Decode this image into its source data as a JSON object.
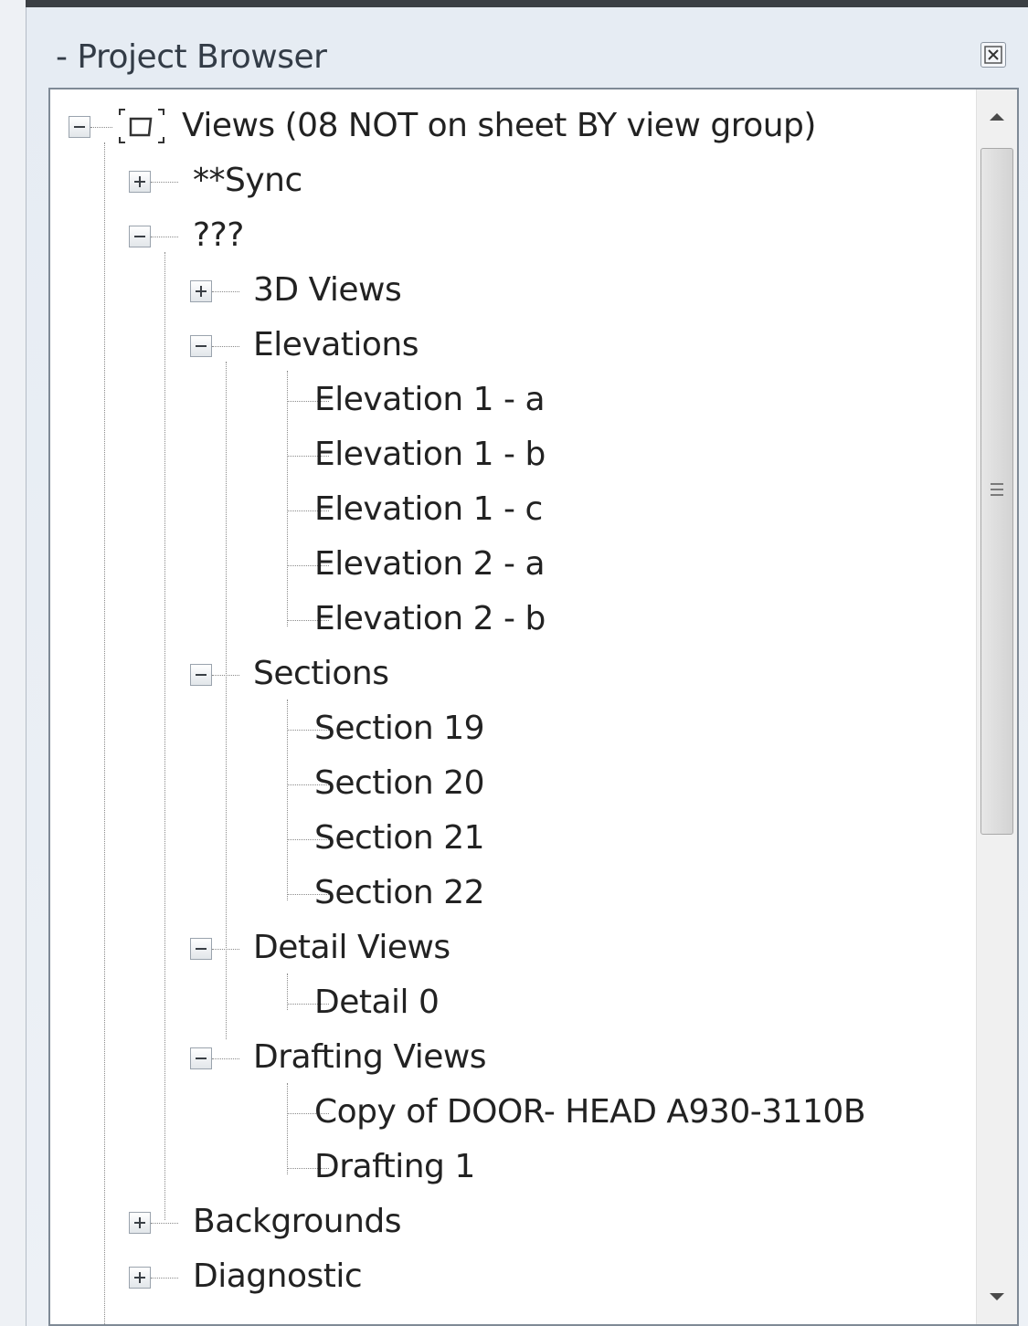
{
  "panel": {
    "title": "- Project Browser",
    "close_icon": "close-icon"
  },
  "tree": {
    "root": "Views (08 NOT on sheet BY view group)",
    "sync": "**Sync",
    "group": "???",
    "views3d": "3D Views",
    "elevations": {
      "label": "Elevations",
      "items": [
        "Elevation 1 - a",
        "Elevation 1 - b",
        "Elevation 1 - c",
        "Elevation 2 - a",
        "Elevation 2 - b"
      ]
    },
    "sections": {
      "label": "Sections",
      "items": [
        "Section 19",
        "Section 20",
        "Section 21",
        "Section 22"
      ]
    },
    "details": {
      "label": "Detail Views",
      "items": [
        "Detail 0"
      ]
    },
    "drafting": {
      "label": "Drafting Views",
      "items": [
        "Copy of DOOR- HEAD A930-3110B",
        "Drafting 1"
      ]
    },
    "backgrounds": "Backgrounds",
    "diagnostic": "Diagnostic"
  },
  "scrollbar": {
    "position": 0.0
  }
}
